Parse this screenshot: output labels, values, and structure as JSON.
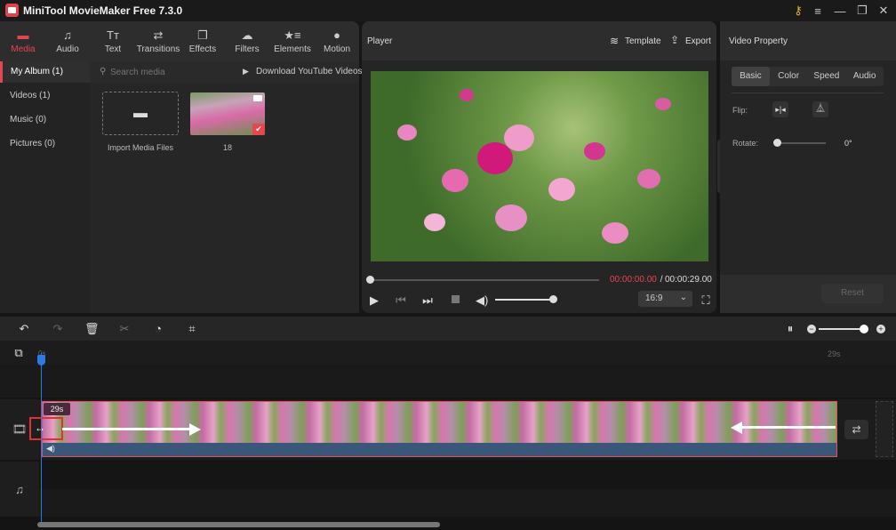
{
  "app": {
    "title": "MiniTool MovieMaker Free 7.3.0"
  },
  "window_controls": {
    "key": "key-icon",
    "menu": "menu-icon",
    "minimize": "minimize-icon",
    "maximize": "restore-icon",
    "close": "close-icon"
  },
  "toolbar": {
    "tabs": [
      {
        "label": "Media",
        "icon": "folder-icon",
        "active": true
      },
      {
        "label": "Audio",
        "icon": "music-note-icon"
      },
      {
        "label": "Text",
        "icon": "text-icon"
      },
      {
        "label": "Transitions",
        "icon": "swap-arrows-icon"
      },
      {
        "label": "Effects",
        "icon": "layers-icon"
      },
      {
        "label": "Filters",
        "icon": "filters-icon"
      },
      {
        "label": "Elements",
        "icon": "elements-icon"
      },
      {
        "label": "Motion",
        "icon": "motion-icon"
      }
    ]
  },
  "sidebar": {
    "items": [
      {
        "label": "My Album (1)",
        "active": true
      },
      {
        "label": "Videos (1)"
      },
      {
        "label": "Music (0)"
      },
      {
        "label": "Pictures (0)"
      }
    ]
  },
  "media": {
    "search_placeholder": "Search media",
    "download_label": "Download YouTube Videos",
    "import_label": "Import Media Files",
    "clip_name": "18"
  },
  "player": {
    "title": "Player",
    "template_label": "Template",
    "export_label": "Export",
    "current_time": "00:00:00.00",
    "separator": " / ",
    "total_time": "00:00:29.00",
    "progress": 0,
    "volume": 1.0,
    "aspect_ratio": "16:9"
  },
  "properties": {
    "title": "Video Property",
    "tabs": [
      {
        "label": "Basic",
        "active": true
      },
      {
        "label": "Color"
      },
      {
        "label": "Speed"
      },
      {
        "label": "Audio"
      }
    ],
    "flip_label": "Flip:",
    "rotate_label": "Rotate:",
    "rotate_value": "0°",
    "reset_label": "Reset"
  },
  "timeline": {
    "ruler_start": "0s",
    "ruler_end": "29s",
    "clip_duration": "29s",
    "zoom_level": 1.0
  },
  "colors": {
    "accent": "#e4484f",
    "playhead": "#2c7be5",
    "time_current": "#e4484f"
  }
}
